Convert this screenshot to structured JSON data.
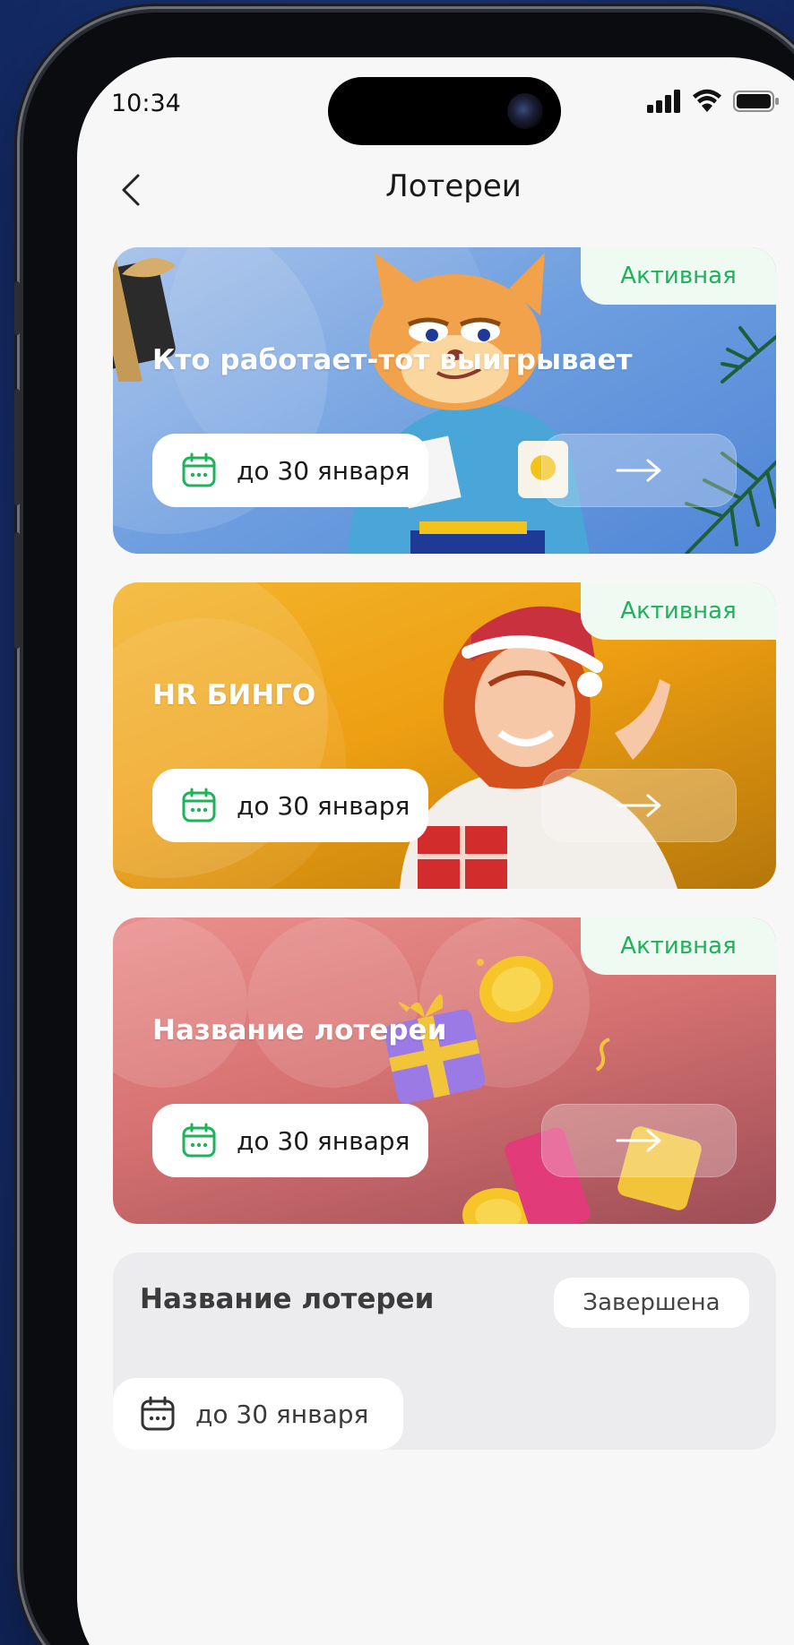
{
  "status_bar": {
    "time": "10:34"
  },
  "header": {
    "title": "Лотереи"
  },
  "lotteries": [
    {
      "title": "Кто работает-тот выигрывает",
      "status": "Активная",
      "date": "до 30 января"
    },
    {
      "title": "HR БИНГО",
      "status": "Активная",
      "date": "до 30 января"
    },
    {
      "title": "Название лотереи",
      "status": "Активная",
      "date": "до 30 января"
    },
    {
      "title": "Название лотереи",
      "status": "Завершена",
      "date": "до 30 января"
    }
  ],
  "colors": {
    "accent_green": "#1fb25b",
    "card_blue": "#6f9fe0",
    "card_orange": "#ee9f12",
    "card_red": "#d77272",
    "card_finished": "#ececee"
  },
  "icons": {
    "back": "chevron-left-icon",
    "calendar": "calendar-icon",
    "arrow": "arrow-right-icon",
    "signal": "signal-icon",
    "wifi": "wifi-icon",
    "battery": "battery-icon"
  }
}
